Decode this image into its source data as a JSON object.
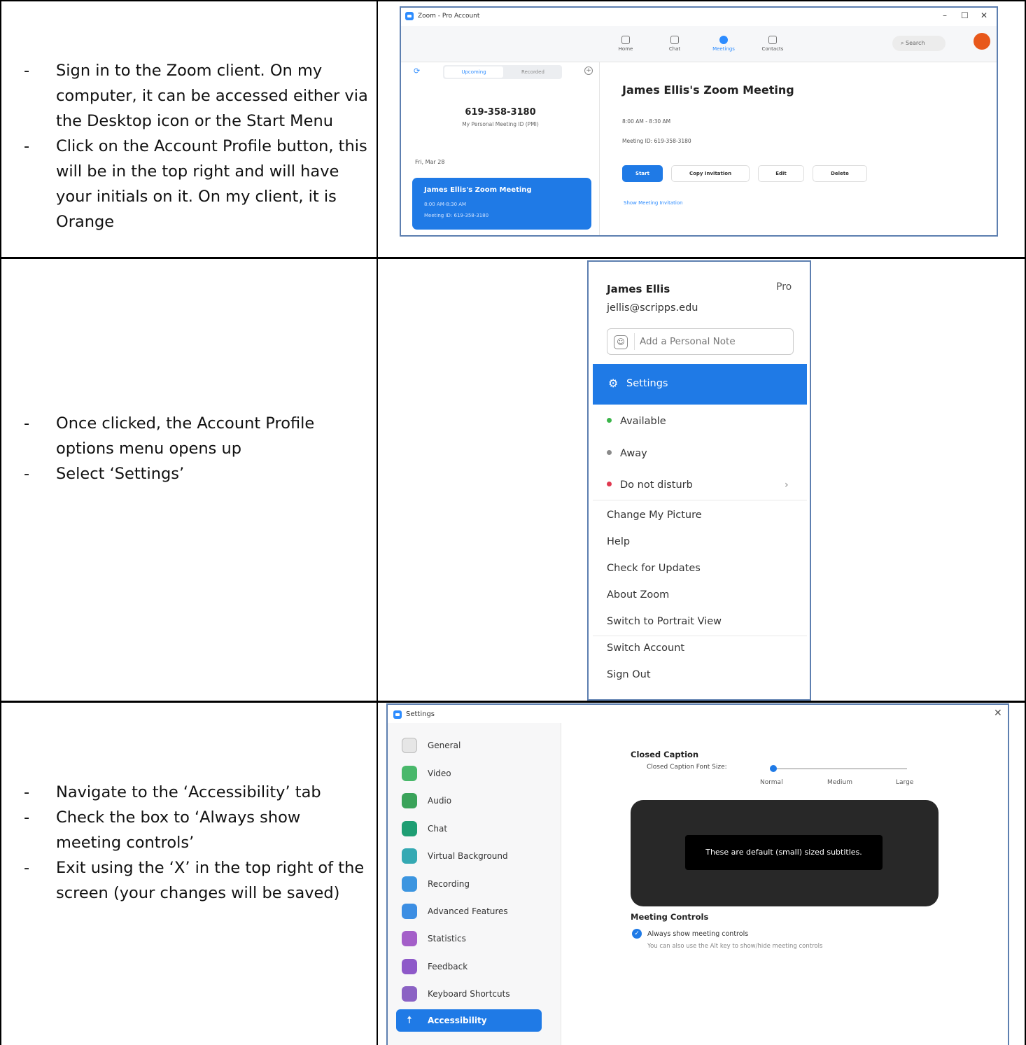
{
  "rows": [
    {
      "instructions": [
        "Sign in to the Zoom client. On my computer, it can be accessed either via the Desktop icon or the Start Menu",
        "Click on the Account Profile button, this will be in the top right and will have your initials on it. On my client, it is Orange"
      ]
    },
    {
      "instructions": [
        "Once clicked, the Account Profile options menu opens up",
        "Select ‘Settings’"
      ]
    },
    {
      "instructions": [
        "Navigate to the ‘Accessibility’ tab",
        "Check the box to ‘Always show meeting controls’",
        "Exit using the ‘X’ in the top right of the screen (your changes will be saved)"
      ]
    }
  ],
  "zoom_window": {
    "title": "Zoom - Pro Account",
    "window_controls": [
      "–",
      "☐",
      "✕"
    ],
    "nav_tabs": [
      "Home",
      "Chat",
      "Meetings",
      "Contacts"
    ],
    "active_tab": "Meetings",
    "search_placeholder": "Search",
    "segments": [
      "Upcoming",
      "Recorded"
    ],
    "pmi_number": "619-358-3180",
    "pmi_label": "My Personal Meeting ID (PMI)",
    "date": "Fri, Mar 28",
    "card_title": "James Ellis's Zoom Meeting",
    "card_time": "8:00 AM-8:30 AM",
    "card_id": "Meeting ID: 619-358-3180",
    "meeting_title": "James Ellis's Zoom Meeting",
    "meeting_time": "8:00 AM - 8:30 AM",
    "meeting_id": "Meeting ID: 619-358-3180",
    "buttons": [
      "Start",
      "Copy Invitation",
      "Edit",
      "Delete"
    ],
    "show_invitation": "Show Meeting Invitation",
    "avatar_color": "#e8581b"
  },
  "profile_menu": {
    "name": "James Ellis",
    "plan": "Pro",
    "email": "jellis@scripps.edu",
    "note_placeholder": "Add a Personal Note",
    "settings_label": "Settings",
    "statuses": [
      {
        "label": "Available",
        "color": "#3bb54a"
      },
      {
        "label": "Away",
        "color": "#8a8a8a"
      },
      {
        "label": "Do not disturb",
        "color": "#e0384f"
      }
    ],
    "items": [
      "Change My Picture",
      "Help",
      "Check for Updates",
      "About Zoom",
      "Switch to Portrait View"
    ],
    "account_items": [
      "Switch Account",
      "Sign Out"
    ],
    "accent": "#1f7ae6"
  },
  "settings_window": {
    "title": "Settings",
    "nav": [
      {
        "label": "General",
        "color": "#e6e6e6"
      },
      {
        "label": "Video",
        "color": "#49b86b"
      },
      {
        "label": "Audio",
        "color": "#3aa35a"
      },
      {
        "label": "Chat",
        "color": "#1e9e73"
      },
      {
        "label": "Virtual Background",
        "color": "#35a9b3"
      },
      {
        "label": "Recording",
        "color": "#3c95e0"
      },
      {
        "label": "Advanced Features",
        "color": "#3c8ee3"
      },
      {
        "label": "Statistics",
        "color": "#a45fc9"
      },
      {
        "label": "Feedback",
        "color": "#8e59c9"
      },
      {
        "label": "Keyboard Shortcuts",
        "color": "#8b62c4"
      },
      {
        "label": "Accessibility",
        "color": "#1f7ae6"
      }
    ],
    "active_nav": "Accessibility",
    "closed_caption_heading": "Closed Caption",
    "font_size_label": "Closed Caption Font Size:",
    "font_sizes": [
      "Normal",
      "Medium",
      "Large"
    ],
    "selected_font_size": "Normal",
    "preview_text": "These are default (small) sized subtitles.",
    "meeting_controls_heading": "Meeting Controls",
    "always_show_label": "Always show meeting controls",
    "always_show_checked": true,
    "hint": "You can also use the Alt key to show/hide meeting controls"
  }
}
